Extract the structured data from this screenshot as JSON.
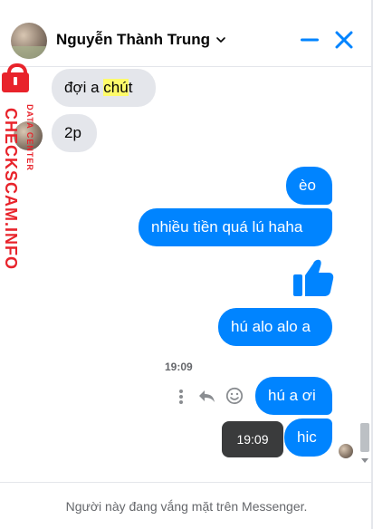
{
  "header": {
    "contact_name": "Nguyễn Thành Trung",
    "avatar_icon": "profile-photo",
    "chevron_icon": "chevron-down-icon",
    "minimize_icon": "minimize-icon",
    "close_icon": "close-icon",
    "accent_color": "#0084ff"
  },
  "messages": [
    {
      "side": "incoming",
      "text_before": "đợi a ",
      "highlight": "chú",
      "text_after": "t"
    },
    {
      "side": "incoming",
      "text": "2p"
    },
    {
      "side": "outgoing",
      "text": "èo"
    },
    {
      "side": "outgoing",
      "text": "nhiều tiền quá lú haha"
    },
    {
      "side": "outgoing",
      "type": "thumbs-up",
      "icon": "thumbs-up-icon"
    },
    {
      "side": "outgoing",
      "text": "hú alo alo a"
    },
    {
      "side": "outgoing",
      "text": "hú a ơi"
    },
    {
      "side": "outgoing",
      "text": "hic"
    }
  ],
  "timestamp_label": "19:09",
  "tooltip_time": "19:09",
  "message_actions": [
    "more-icon",
    "reply-icon",
    "emoji-icon"
  ],
  "watermark": {
    "main": "CHECKSCAM.INFO",
    "sub": "DATA CENTER",
    "color": "#e8232b"
  },
  "footer": {
    "status": "Người này đang vắng mặt trên Messenger."
  }
}
